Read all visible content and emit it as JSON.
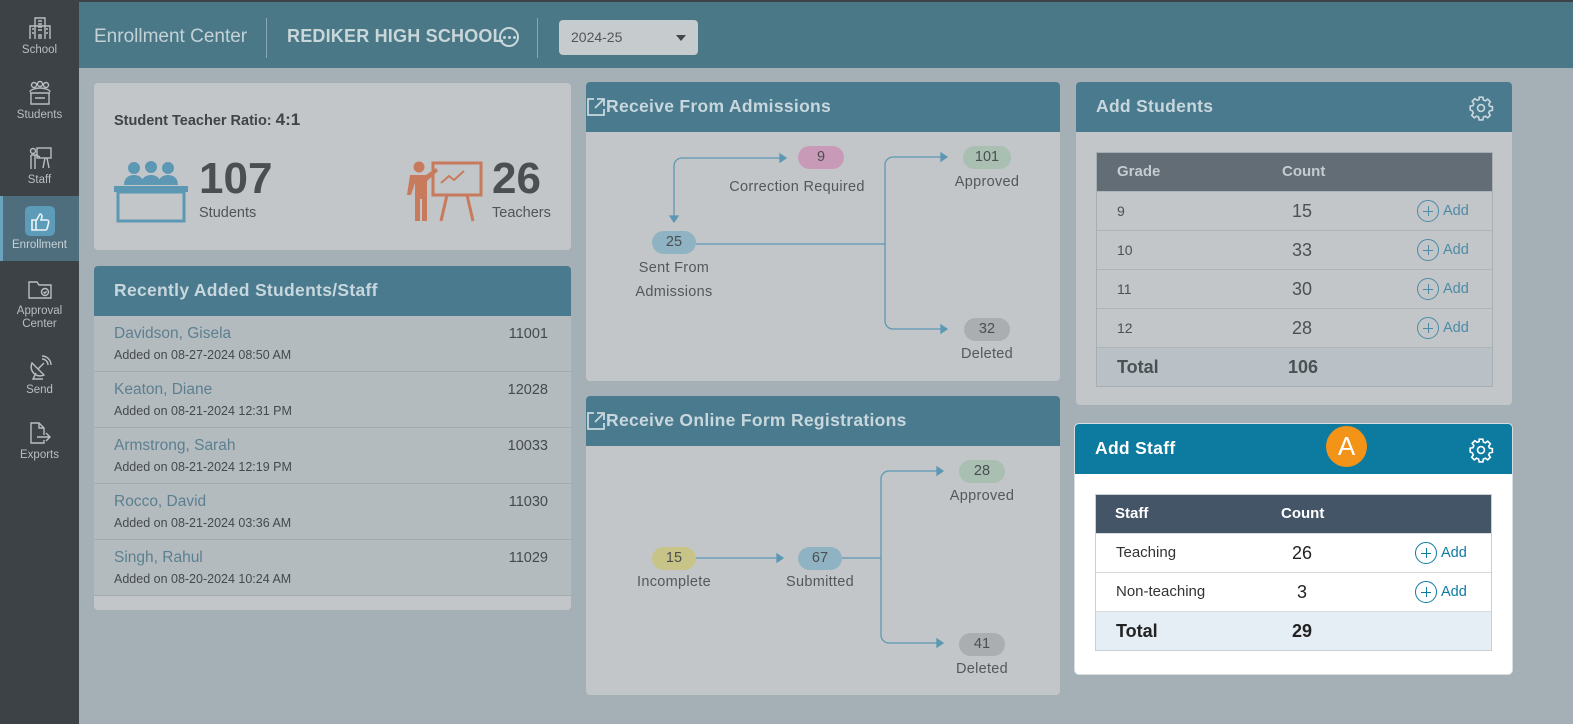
{
  "sidebar": {
    "items": [
      {
        "label": "School",
        "icon": "school-icon"
      },
      {
        "label": "Students",
        "icon": "students-icon"
      },
      {
        "label": "Staff",
        "icon": "staff-icon"
      },
      {
        "label": "Enrollment",
        "icon": "thumbs-up-icon",
        "active": true
      },
      {
        "label": "Approval Center",
        "icon": "folder-icon"
      },
      {
        "label": "Send",
        "icon": "satellite-dish-icon"
      },
      {
        "label": "Exports",
        "icon": "export-file-icon"
      }
    ]
  },
  "header": {
    "app_title": "Enrollment Center",
    "school_name": "REDIKER HIGH SCHOOL",
    "school_year": "2024-25"
  },
  "ratio_card": {
    "label": "Student Teacher Ratio:",
    "ratio": "4:1",
    "students_count": "107",
    "students_label": "Students",
    "teachers_count": "26",
    "teachers_label": "Teachers"
  },
  "recent": {
    "title": "Recently Added Students/Staff",
    "rows": [
      {
        "name": "Davidson, Gisela",
        "id": "11001",
        "added": "Added on 08-27-2024 08:50 AM"
      },
      {
        "name": "Keaton, Diane",
        "id": "12028",
        "added": "Added on 08-21-2024 12:31 PM"
      },
      {
        "name": "Armstrong, Sarah",
        "id": "10033",
        "added": "Added on 08-21-2024 12:19 PM"
      },
      {
        "name": "Rocco, David",
        "id": "11030",
        "added": "Added on 08-21-2024 03:36 AM"
      },
      {
        "name": "Singh, Rahul",
        "id": "11029",
        "added": "Added on 08-20-2024 10:24 AM"
      }
    ]
  },
  "admissions": {
    "title": "Receive From Admissions",
    "correction_count": "9",
    "correction_label": "Correction Required",
    "sent_count": "25",
    "sent_label_line1": "Sent From",
    "sent_label_line2": "Admissions",
    "approved_count": "101",
    "approved_label": "Approved",
    "deleted_count": "32",
    "deleted_label": "Deleted"
  },
  "online": {
    "title": "Receive Online Form Registrations",
    "incomplete_count": "15",
    "incomplete_label": "Incomplete",
    "submitted_count": "67",
    "submitted_label": "Submitted",
    "approved_count": "28",
    "approved_label": "Approved",
    "deleted_count": "41",
    "deleted_label": "Deleted"
  },
  "add_students": {
    "title": "Add Students",
    "col_grade": "Grade",
    "col_count": "Count",
    "add_label": "Add",
    "rows": [
      {
        "grade": "9",
        "count": "15"
      },
      {
        "grade": "10",
        "count": "33"
      },
      {
        "grade": "11",
        "count": "30"
      },
      {
        "grade": "12",
        "count": "28"
      }
    ],
    "total_label": "Total",
    "total": "106"
  },
  "add_staff": {
    "title": "Add Staff",
    "marker": "A",
    "col_staff": "Staff",
    "col_count": "Count",
    "add_label": "Add",
    "rows": [
      {
        "type": "Teaching",
        "count": "26"
      },
      {
        "type": "Non-teaching",
        "count": "3"
      }
    ],
    "total_label": "Total",
    "total": "29"
  },
  "colors": {
    "header": "#4a7887",
    "staff_accent": "#0d7aa0",
    "marker": "#f39317",
    "teacher_icon": "#c77a5c",
    "students_icon": "#5c98b3"
  }
}
